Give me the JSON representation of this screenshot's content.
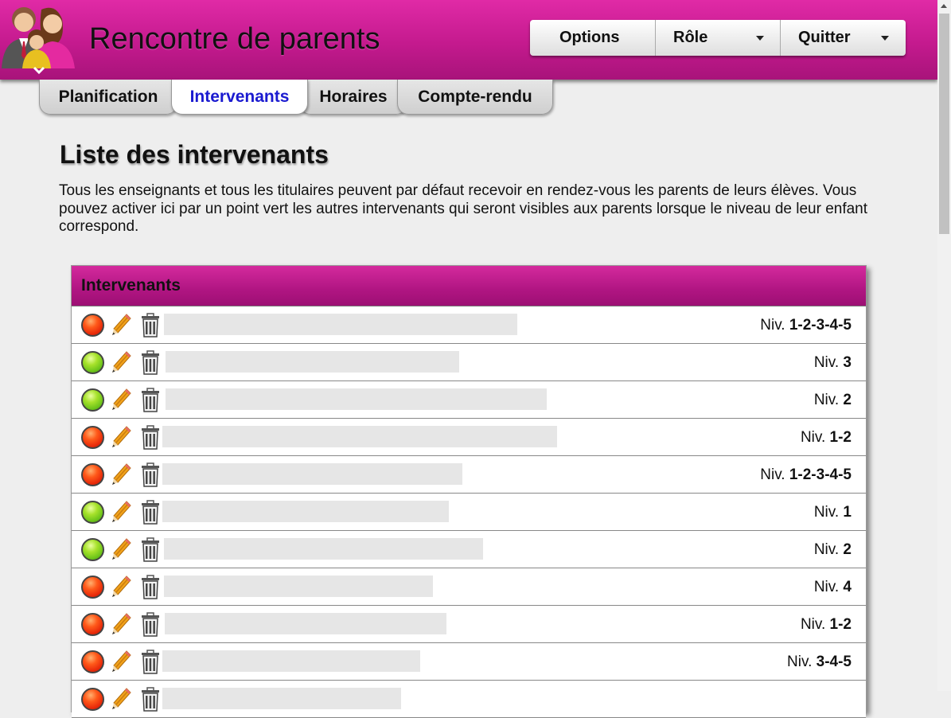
{
  "app": {
    "title": "Rencontre de parents",
    "logo_icon": "parents-family-icon"
  },
  "top_menu": {
    "options_label": "Options",
    "role_label": "Rôle",
    "quit_label": "Quitter"
  },
  "tabs": [
    {
      "label": "Planification",
      "active": false
    },
    {
      "label": "Intervenants",
      "active": true
    },
    {
      "label": "Horaires",
      "active": false
    },
    {
      "label": "Compte-rendu",
      "active": false
    }
  ],
  "page": {
    "title": "Liste des intervenants",
    "description": "Tous les enseignants et tous les titulaires peuvent par défaut recevoir en rendez-vous les parents de leurs élèves. Vous pouvez activer ici par un point vert les autres intervenants qui seront visibles aux parents lorsque le niveau de leur enfant correspond."
  },
  "panel": {
    "title": "Intervenants",
    "level_prefix": "Niv.",
    "rows": [
      {
        "status": "red",
        "levels": "1-2-3-4-5"
      },
      {
        "status": "green",
        "levels": "3"
      },
      {
        "status": "green",
        "levels": "2"
      },
      {
        "status": "red",
        "levels": "1-2"
      },
      {
        "status": "red",
        "levels": "1-2-3-4-5"
      },
      {
        "status": "green",
        "levels": "1"
      },
      {
        "status": "green",
        "levels": "2"
      },
      {
        "status": "red",
        "levels": "4"
      },
      {
        "status": "red",
        "levels": "1-2"
      },
      {
        "status": "red",
        "levels": "3-4-5"
      },
      {
        "status": "red",
        "levels": ""
      }
    ]
  },
  "colors": {
    "header_magenta": "#c41a8e",
    "active_tab_text": "#1a1ad0",
    "status_red": "#e82a0a",
    "status_green": "#6cc41a"
  }
}
